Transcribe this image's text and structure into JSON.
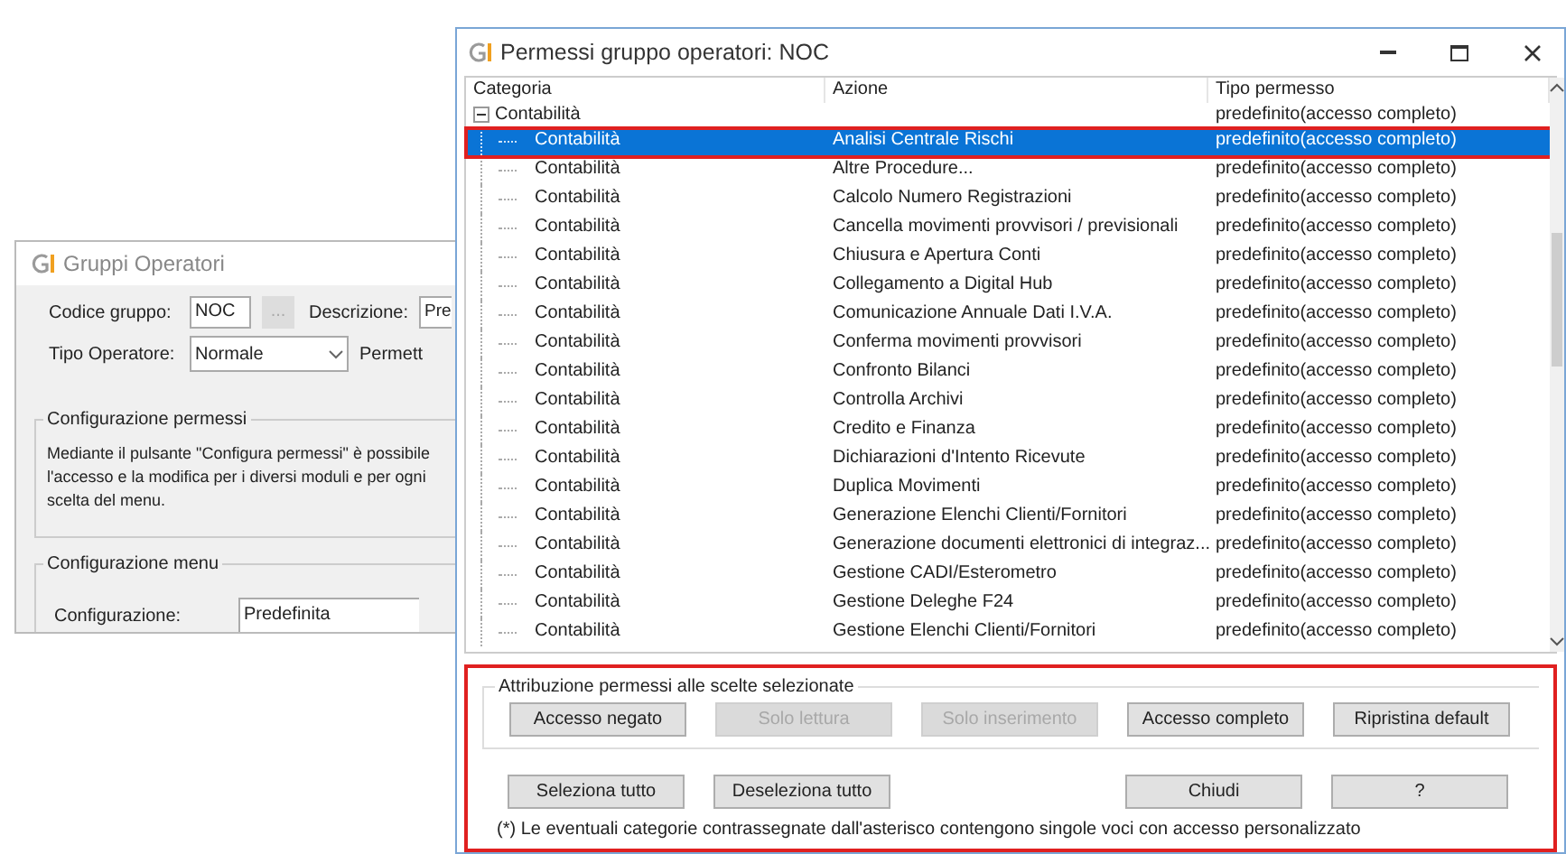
{
  "back_window": {
    "title": "Gruppi Operatori",
    "group_code": {
      "label": "Codice gruppo:",
      "value": "NOC",
      "browse": "..."
    },
    "description": {
      "label": "Descrizione:",
      "value": "Pre"
    },
    "operator_type": {
      "label": "Tipo Operatore:",
      "value": "Normale",
      "trailing_label": "Permett"
    },
    "permissions_group": {
      "title": "Configurazione permessi",
      "text": "Mediante il pulsante \"Configura permessi\" è possibile l'accesso e la modifica per i diversi moduli e per ogni scelta del menu."
    },
    "menu_group": {
      "title": "Configurazione menu",
      "label": "Configurazione:",
      "value": "Predefinita"
    }
  },
  "window": {
    "title": "Permessi gruppo operatori: NOC",
    "columns": [
      "Categoria",
      "Azione",
      "Tipo permesso"
    ],
    "tree": {
      "label": "Contabilità",
      "permission": "predefinito(accesso completo)",
      "expanded": true,
      "children": [
        {
          "category": "Contabilità",
          "action": "Analisi Centrale Rischi",
          "permission": "predefinito(accesso completo)",
          "selected": true
        },
        {
          "category": "Contabilità",
          "action": "Altre Procedure...",
          "permission": "predefinito(accesso completo)",
          "selected": false
        },
        {
          "category": "Contabilità",
          "action": "Calcolo Numero Registrazioni",
          "permission": "predefinito(accesso completo)",
          "selected": false
        },
        {
          "category": "Contabilità",
          "action": "Cancella movimenti provvisori / previsionali",
          "permission": "predefinito(accesso completo)",
          "selected": false
        },
        {
          "category": "Contabilità",
          "action": "Chiusura e Apertura Conti",
          "permission": "predefinito(accesso completo)",
          "selected": false
        },
        {
          "category": "Contabilità",
          "action": "Collegamento a Digital Hub",
          "permission": "predefinito(accesso completo)",
          "selected": false
        },
        {
          "category": "Contabilità",
          "action": "Comunicazione Annuale Dati I.V.A.",
          "permission": "predefinito(accesso completo)",
          "selected": false
        },
        {
          "category": "Contabilità",
          "action": "Conferma movimenti provvisori",
          "permission": "predefinito(accesso completo)",
          "selected": false
        },
        {
          "category": "Contabilità",
          "action": "Confronto Bilanci",
          "permission": "predefinito(accesso completo)",
          "selected": false
        },
        {
          "category": "Contabilità",
          "action": "Controlla Archivi",
          "permission": "predefinito(accesso completo)",
          "selected": false
        },
        {
          "category": "Contabilità",
          "action": "Credito e Finanza",
          "permission": "predefinito(accesso completo)",
          "selected": false
        },
        {
          "category": "Contabilità",
          "action": "Dichiarazioni d'Intento Ricevute",
          "permission": "predefinito(accesso completo)",
          "selected": false
        },
        {
          "category": "Contabilità",
          "action": "Duplica Movimenti",
          "permission": "predefinito(accesso completo)",
          "selected": false
        },
        {
          "category": "Contabilità",
          "action": "Generazione Elenchi Clienti/Fornitori",
          "permission": "predefinito(accesso completo)",
          "selected": false
        },
        {
          "category": "Contabilità",
          "action": "Generazione documenti elettronici di integraz...",
          "permission": "predefinito(accesso completo)",
          "selected": false
        },
        {
          "category": "Contabilità",
          "action": "Gestione CADI/Esterometro",
          "permission": "predefinito(accesso completo)",
          "selected": false
        },
        {
          "category": "Contabilità",
          "action": "Gestione Deleghe F24",
          "permission": "predefinito(accesso completo)",
          "selected": false
        },
        {
          "category": "Contabilità",
          "action": "Gestione Elenchi Clienti/Fornitori",
          "permission": "predefinito(accesso completo)",
          "selected": false
        }
      ]
    },
    "assign_group": {
      "title": "Attribuzione permessi alle scelte selezionate",
      "buttons": [
        {
          "label": "Accesso negato",
          "disabled": false
        },
        {
          "label": "Solo lettura",
          "disabled": true
        },
        {
          "label": "Solo inserimento",
          "disabled": true
        },
        {
          "label": "Accesso completo",
          "disabled": false
        },
        {
          "label": "Ripristina default",
          "disabled": false
        }
      ]
    },
    "bottom_buttons": [
      {
        "label": "Seleziona tutto"
      },
      {
        "label": "Deseleziona tutto"
      },
      {
        "label": "Chiudi"
      },
      {
        "label": "?"
      }
    ],
    "note": "(*) Le eventuali categorie contrassegnate dall'asterisco contengono singole voci con accesso personalizzato"
  }
}
